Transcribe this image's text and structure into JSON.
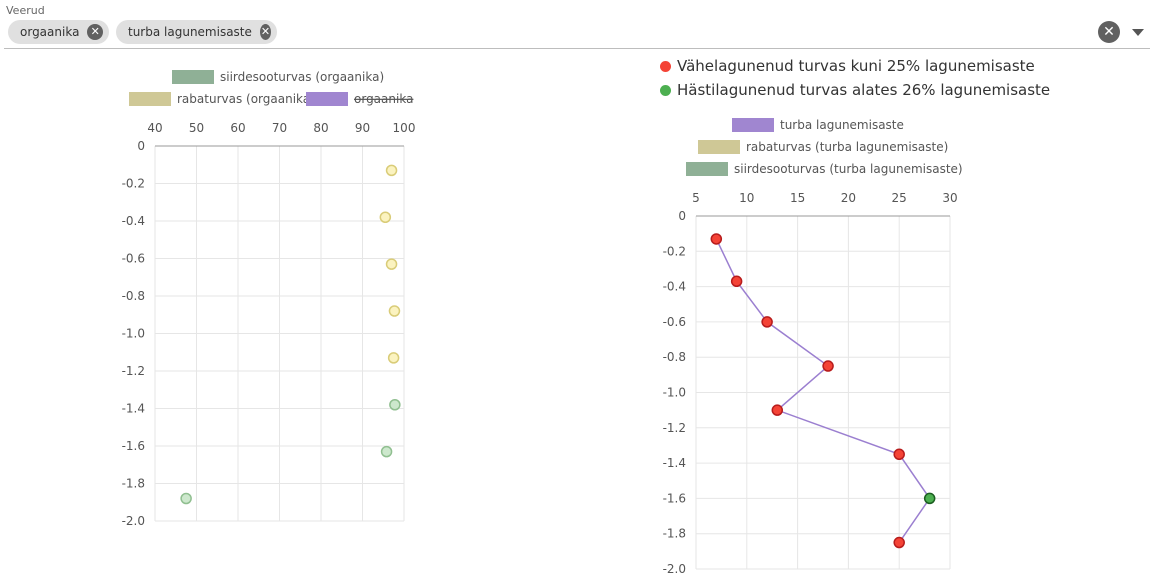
{
  "header": {
    "label": "Veerud",
    "chips": [
      {
        "label": "orgaanika"
      },
      {
        "label": "turba lagunemisaste"
      }
    ],
    "remove_glyph": "✕",
    "clear_glyph": "✕"
  },
  "status_legend": [
    {
      "label": "Vähelagunenud turvas kuni 25% lagunemisaste",
      "color": "#f44336"
    },
    {
      "label": "Hästilagunenud turvas alates 26% lagunemisaste",
      "color": "#4caf50"
    }
  ],
  "chart_data": [
    {
      "type": "scatter",
      "xlim": [
        40,
        100
      ],
      "ylim": [
        -2.0,
        0
      ],
      "x_ticks": [
        "40",
        "50",
        "60",
        "70",
        "80",
        "90",
        "100"
      ],
      "y_ticks": [
        "0",
        "-0.2",
        "-0.4",
        "-0.6",
        "-0.8",
        "-1.0",
        "-1.2",
        "-1.4",
        "-1.6",
        "-1.8",
        "-2.0"
      ],
      "grid": true,
      "legend_placement": "top",
      "legend": [
        {
          "name": "siirdesooturvas (orgaanika)",
          "color": "#8fb096",
          "hidden": false
        },
        {
          "name": "rabaturvas (orgaanika)",
          "color": "#cfc896",
          "hidden": false
        },
        {
          "name": "orgaanika",
          "color": "#a086d0",
          "hidden": true
        }
      ],
      "series": [
        {
          "name": "rabaturvas (orgaanika)",
          "fill": "#fbf3c0",
          "stroke": "#d9cc78",
          "points": [
            [
              97,
              -0.13
            ],
            [
              95.5,
              -0.38
            ],
            [
              97,
              -0.63
            ],
            [
              97.7,
              -0.88
            ],
            [
              97.5,
              -1.13
            ]
          ]
        },
        {
          "name": "siirdesooturvas (orgaanika)",
          "fill": "#cde8cd",
          "stroke": "#90bf90",
          "points": [
            [
              97.8,
              -1.38
            ],
            [
              95.8,
              -1.63
            ],
            [
              47.5,
              -1.88
            ]
          ]
        }
      ]
    },
    {
      "type": "line",
      "xlim": [
        5,
        30
      ],
      "ylim": [
        -2.0,
        0
      ],
      "x_ticks": [
        "5",
        "10",
        "15",
        "20",
        "25",
        "30"
      ],
      "y_ticks": [
        "0",
        "-0.2",
        "-0.4",
        "-0.6",
        "-0.8",
        "-1.0",
        "-1.2",
        "-1.4",
        "-1.6",
        "-1.8",
        "-2.0"
      ],
      "grid": true,
      "legend_placement": "top",
      "legend": [
        {
          "name": "turba lagunemisaste",
          "color": "#a086d0",
          "hidden": false
        },
        {
          "name": "rabaturvas (turba lagunemisaste)",
          "color": "#cfc896",
          "hidden": false
        },
        {
          "name": "siirdesooturvas (turba lagunemisaste)",
          "color": "#8fb096",
          "hidden": false
        }
      ],
      "series": [
        {
          "name": "turba lagunemisaste",
          "line_color": "#9b7fd0",
          "points": [
            {
              "x": 7,
              "y": -0.13,
              "status": "low"
            },
            {
              "x": 9,
              "y": -0.37,
              "status": "low"
            },
            {
              "x": 12,
              "y": -0.6,
              "status": "low"
            },
            {
              "x": 18,
              "y": -0.85,
              "status": "low"
            },
            {
              "x": 13,
              "y": -1.1,
              "status": "low"
            },
            {
              "x": 25,
              "y": -1.35,
              "status": "low"
            },
            {
              "x": 28,
              "y": -1.6,
              "status": "high"
            },
            {
              "x": 25,
              "y": -1.85,
              "status": "low"
            }
          ]
        }
      ],
      "status_colors": {
        "low": {
          "fill": "#f44336",
          "stroke": "#b71c1c"
        },
        "high": {
          "fill": "#4caf50",
          "stroke": "#1b5e20"
        }
      }
    }
  ]
}
